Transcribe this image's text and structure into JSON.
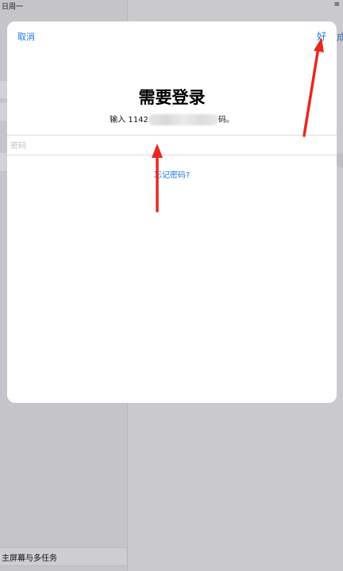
{
  "status_bar": {
    "time": "日周一"
  },
  "background": {
    "bottom_sidebar_item": "主屏幕与多任务",
    "right_edge_link": "成"
  },
  "dialog": {
    "cancel_label": "取消",
    "done_label": "好",
    "title": "需要登录",
    "message_prefix": "输入 1142",
    "message_suffix": "码。",
    "password_placeholder": "密码",
    "password_value": "",
    "forgot_link": "忘记密码?"
  },
  "annotation": {
    "color": "#e8281e"
  }
}
